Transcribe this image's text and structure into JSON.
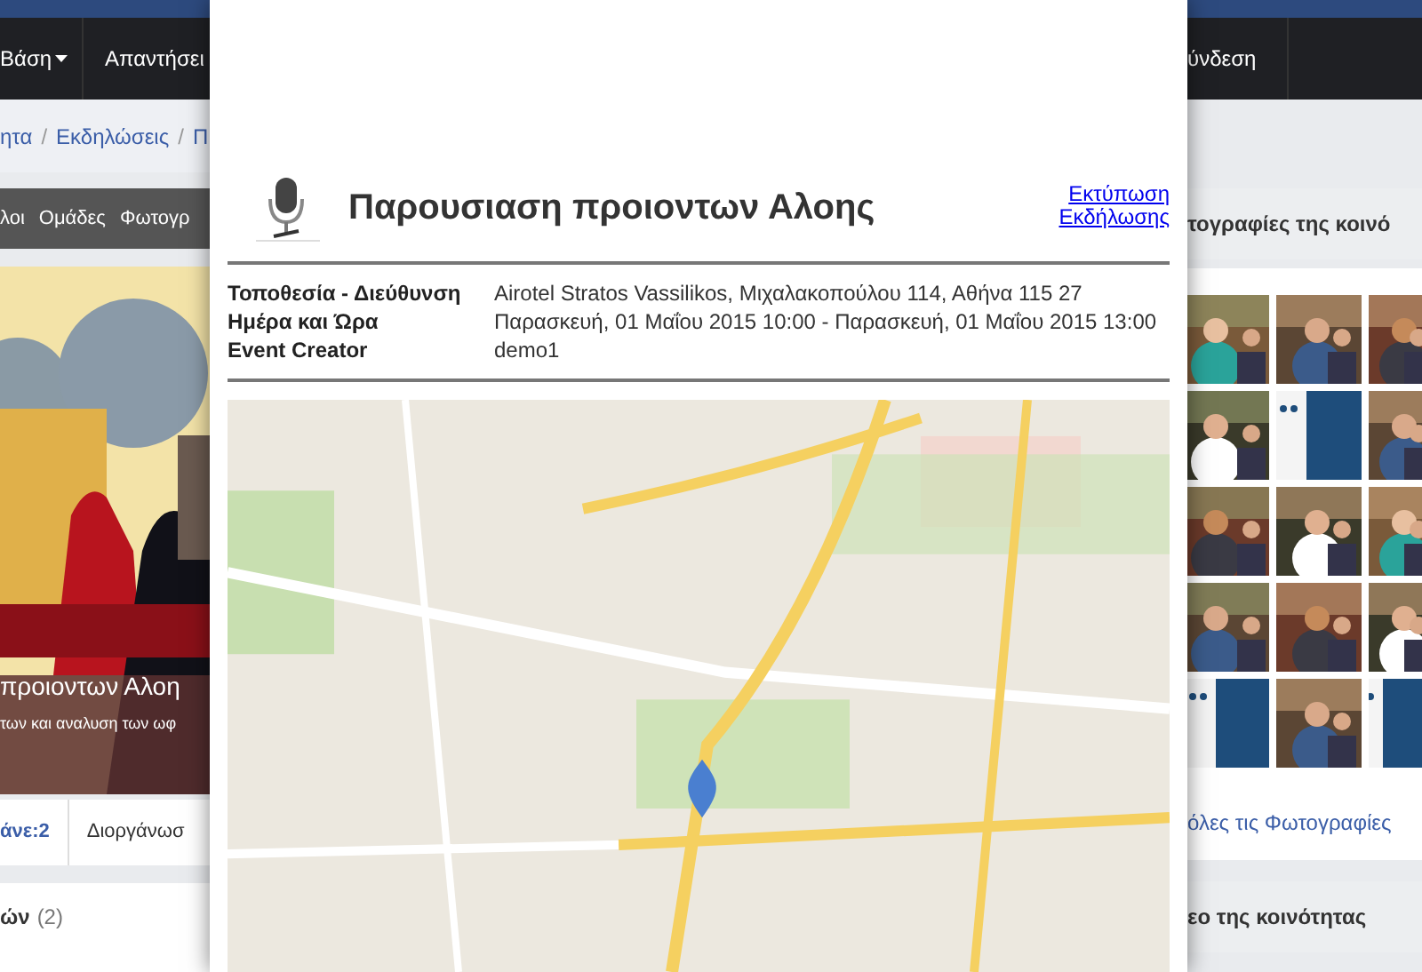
{
  "background_page": {
    "navbar": {
      "left_items": [
        {
          "label": "Βάση",
          "kind": "dropdown"
        },
        {
          "label": "Απαντήσει",
          "kind": "link"
        }
      ],
      "right_items": [
        "ύνδεση"
      ]
    },
    "breadcrumb": {
      "separator": "/",
      "items": [
        "ητα",
        "Εκδηλώσεις",
        "Π"
      ]
    },
    "tabs": [
      "λοι",
      "Ομάδες",
      "Φωτογρ"
    ],
    "hero": {
      "title": "προιοντων Αλοη",
      "subtitle": "των και αναλυση των ωφ"
    },
    "stats": [
      {
        "label": "άνε:2",
        "kind": "count"
      },
      {
        "label": "Διοργάνωσ",
        "kind": "tab"
      }
    ],
    "section": {
      "title": "ών",
      "count": "(2)"
    },
    "photos_panel": {
      "title": "τογραφίες της κοινό",
      "photos": [
        {
          "kind": "picture"
        },
        {
          "kind": "picture"
        },
        {
          "kind": "picture"
        },
        {
          "kind": "picture"
        },
        {
          "kind": "picture"
        },
        {
          "kind": "picture"
        },
        {
          "kind": "picture"
        },
        {
          "kind": "picture"
        },
        {
          "kind": "picture"
        },
        {
          "kind": "picture"
        },
        {
          "kind": "picture"
        },
        {
          "kind": "picture"
        },
        {
          "kind": "picture"
        },
        {
          "kind": "picture"
        },
        {
          "kind": "picture"
        }
      ],
      "link": "όλες τις Φωτογραφίες"
    },
    "video_panel": {
      "title": "εο της κοινότητας"
    }
  },
  "modal": {
    "title": "Παρουσιαση προιοντων Αλοης",
    "print_link": [
      "Εκτύπωση",
      "Εκδήλωσης"
    ],
    "details": [
      {
        "label": "Τοποθεσία - Διεύθυνση",
        "value": "Airotel Stratos Vassilikos, Μιχαλακοπούλου 114, Αθήνα 115 27"
      },
      {
        "label": "Ημέρα και Ώρα",
        "value": "Παρασκευή, 01 Μαΐου 2015 10:00 - Παρασκευή, 01 Μαΐου 2015 13:00"
      },
      {
        "label": "Event Creator",
        "value": "demo1"
      }
    ],
    "map": {
      "kind": "picture"
    }
  }
}
